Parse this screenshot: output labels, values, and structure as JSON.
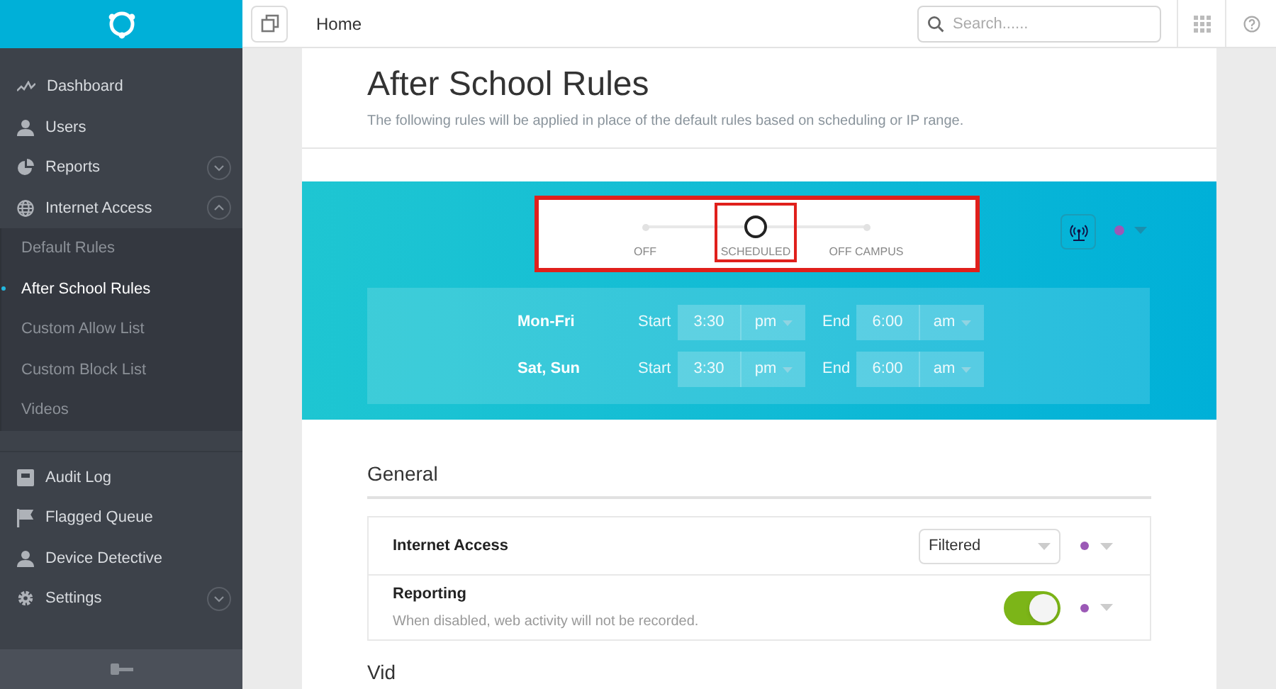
{
  "sidebar": {
    "groups": [
      [
        {
          "label": "Dashboard"
        },
        {
          "label": "Users"
        },
        {
          "label": "Reports",
          "expanded": false
        },
        {
          "label": "Internet Access",
          "expanded": true,
          "children": [
            {
              "label": "Default Rules",
              "selected": false
            },
            {
              "label": "After School Rules",
              "selected": true
            },
            {
              "label": "Custom Allow List",
              "selected": false
            },
            {
              "label": "Custom Block List",
              "selected": false
            },
            {
              "label": "Videos",
              "selected": false
            }
          ]
        }
      ],
      [
        {
          "label": "Audit Log"
        },
        {
          "label": "Flagged Queue"
        },
        {
          "label": "Device Detective"
        },
        {
          "label": "Settings",
          "expanded": false
        }
      ]
    ]
  },
  "topbar": {
    "breadcrumb": "Home",
    "search": {
      "placeholder": "Search......"
    }
  },
  "page": {
    "title": "After School Rules",
    "subtitle": "The following rules will be applied in place of the default rules based on scheduling or IP range."
  },
  "mode_slider": {
    "highlighted": true,
    "stops": [
      {
        "label": "OFF",
        "selected": false,
        "highlighted": false
      },
      {
        "label": "SCHEDULED",
        "selected": true,
        "highlighted": true
      },
      {
        "label": "OFF CAMPUS",
        "selected": false,
        "highlighted": false
      }
    ]
  },
  "mode_status": {
    "color": "#9b59b6"
  },
  "schedule": [
    {
      "days": "Mon-Fri",
      "start_label": "Start",
      "start_time": "3:30",
      "start_period": "pm",
      "end_label": "End",
      "end_time": "6:00",
      "end_period": "am"
    },
    {
      "days": "Sat, Sun",
      "start_label": "Start",
      "start_time": "3:30",
      "start_period": "pm",
      "end_label": "End",
      "end_time": "6:00",
      "end_period": "am"
    }
  ],
  "general": {
    "heading": "General",
    "rows": [
      {
        "kind": "select",
        "label": "Internet Access",
        "value": "Filtered",
        "color": "#9b59b6"
      },
      {
        "kind": "toggle",
        "label": "Reporting",
        "description": "When disabled, web activity will not be recorded.",
        "on": true,
        "color": "#9b59b6"
      }
    ]
  },
  "next_heading": "Vid"
}
